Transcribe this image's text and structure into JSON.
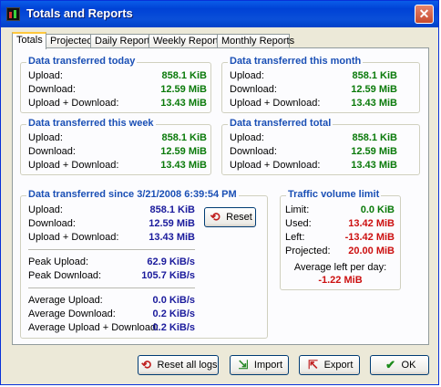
{
  "window": {
    "title": "Totals and Reports",
    "close_glyph": "✕"
  },
  "tabs": [
    "Totals",
    "Projected",
    "Daily Reports",
    "Weekly Reports",
    "Monthly Reports"
  ],
  "labels": {
    "upload": "Upload:",
    "download": "Download:",
    "both": "Upload + Download:"
  },
  "today": {
    "title": "Data transferred today",
    "upload": "858.1 KiB",
    "download": "12.59 MiB",
    "both": "13.43 MiB"
  },
  "month": {
    "title": "Data transferred this month",
    "upload": "858.1 KiB",
    "download": "12.59 MiB",
    "both": "13.43 MiB"
  },
  "week": {
    "title": "Data transferred this week",
    "upload": "858.1 KiB",
    "download": "12.59 MiB",
    "both": "13.43 MiB"
  },
  "total": {
    "title": "Data transferred total",
    "upload": "858.1 KiB",
    "download": "12.59 MiB",
    "both": "13.43 MiB"
  },
  "since": {
    "title": "Data transferred since 3/21/2008 6:39:54 PM",
    "upload": "858.1 KiB",
    "download": "12.59 MiB",
    "both": "13.43 MiB",
    "reset_label": "Reset",
    "peak_upload_label": "Peak Upload:",
    "peak_upload": "62.9 KiB/s",
    "peak_download_label": "Peak Download:",
    "peak_download": "105.7 KiB/s",
    "avg_upload_label": "Average Upload:",
    "avg_upload": "0.0 KiB/s",
    "avg_download_label": "Average Download:",
    "avg_download": "0.2 KiB/s",
    "avg_both_label": "Average Upload + Download:",
    "avg_both": "0.2 KiB/s"
  },
  "limit": {
    "title": "Traffic volume limit",
    "limit_label": "Limit:",
    "limit": "0.0 KiB",
    "used_label": "Used:",
    "used": "13.42 MiB",
    "left_label": "Left:",
    "left": "-13.42 MiB",
    "projected_label": "Projected:",
    "projected": "20.00 MiB",
    "avg_left_label": "Average left per day:",
    "avg_left": "-1.22 MiB"
  },
  "buttons": {
    "reset_all": "Reset all logs",
    "import": "Import",
    "export": "Export",
    "ok": "OK"
  }
}
